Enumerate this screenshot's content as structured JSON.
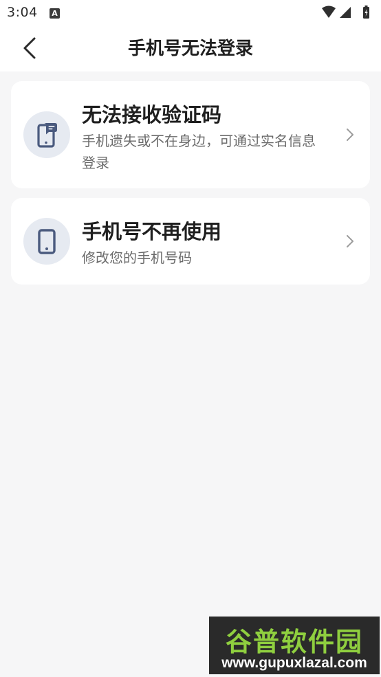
{
  "status_bar": {
    "time": "3:04",
    "notification_badge": "A"
  },
  "header": {
    "title": "手机号无法登录"
  },
  "options": [
    {
      "title": "无法接收验证码",
      "description": "手机遗失或不在身边，可通过实名信息登录",
      "icon": "phone-message-icon"
    },
    {
      "title": "手机号不再使用",
      "description": "修改您的手机号码",
      "icon": "phone-icon"
    }
  ],
  "watermark": {
    "title": "谷普软件园",
    "url": "www.gupuxlazal.com"
  },
  "colors": {
    "background": "#f6f6f7",
    "card": "#ffffff",
    "icon_bg": "#e6eaf1",
    "icon_fg": "#4a5a7e",
    "watermark_green": "#8fcf3f"
  }
}
